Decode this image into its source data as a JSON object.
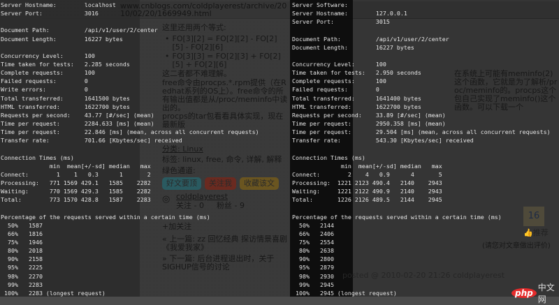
{
  "blog": {
    "url": "www.cnblogs.com/coldplayerest/archive/2010/02/20/1669949.html",
    "p1": "这里还用两个等式:",
    "bullet1": "FO[3][2] = FO[2][2] - FO[2][5] - FO[2][6]",
    "bullet2": "FO[3][3] = FO[2][3] + FO[2][5] + FO[2][6]",
    "p2": "这二者都不难理解。",
    "p3": "free命令由procps.*.rpm提供（在Redhat系列的OS上）。free命令的所有输出值都是从/proc/meminfo中读出的。",
    "p4": "在系统上可能有meminfo(2)这个函数，它就是为了解析/proc/meminfo的。procps这个包自己实现了meminfo()这个函数。可以下载一个",
    "p5": "procps的tar包看看具体实现，现在最新版",
    "category": "分类: Linux",
    "tags": "标签: linux, free, 命令, 详解, 解释",
    "green_channel": "绿色通道:",
    "btn_recommend": "好文要顶",
    "btn_follow": "关注我",
    "btn_favorite": "收藏该文",
    "author": "coldplayerest",
    "following": "关注 - 0",
    "followers": "粉丝 - 9",
    "add_follow": "+加关注",
    "prev": "« 上一篇: zz 回忆经典 探访情景喜剧《我爱我家》",
    "next": "» 下一篇: 后台进程退出时，关于SIGHUP信号的讨论",
    "digg_count": "16",
    "digg_label": "推荐",
    "rate_hint": "(请您对文章做出评价)",
    "posted": "posted @ 2010-02-20 21:26 coldplayerest",
    "logo_php": "php",
    "logo_cn": "中文网"
  },
  "terminal_left": {
    "lines": [
      "Server Hostname:        localhost",
      "Server Port:            3016",
      "",
      "Document Path:          /api/v1/user/2/center",
      "Document Length:        16227 bytes",
      "",
      "Concurrency Level:      100",
      "Time taken for tests:   2.285 seconds",
      "Complete requests:      100",
      "Failed requests:        0",
      "Write errors:           0",
      "Total transferred:      1641500 bytes",
      "HTML transferred:       1622700 bytes",
      "Requests per second:    43.77 [#/sec] (mean)",
      "Time per request:       2284.633 [ms] (mean)",
      "Time per request:       22.846 [ms] (mean, across all concurrent requests)",
      "Transfer rate:          701.66 [Kbytes/sec] received",
      "",
      "Connection Times (ms)",
      "              min  mean[+/-sd] median   max",
      "Connect:        1    1   0.3      1       2",
      "Processing:   771 1569 429.1   1585    2282",
      "Waiting:      770 1569 429.3   1585    2282",
      "Total:        773 1570 428.8   1587    2283",
      "",
      "Percentage of the requests served within a certain time (ms)",
      "  50%   1587",
      "  66%   1816",
      "  75%   1946",
      "  80%   2018",
      "  90%   2158",
      "  95%   2225",
      "  98%   2270",
      "  99%   2283",
      " 100%   2283 (longest request)"
    ]
  },
  "terminal_right": {
    "lines": [
      "Server Software:",
      "Server Hostname:        127.0.0.1",
      "Server Port:            3015",
      "",
      "Document Path:          /api/v1/user/2/center",
      "Document Length:        16227 bytes",
      "",
      "Concurrency Level:      100",
      "Time taken for tests:   2.950 seconds",
      "Complete requests:      100",
      "Failed requests:        0",
      "Total transferred:      1641400 bytes",
      "HTML transferred:       1622700 bytes",
      "Requests per second:    33.89 [#/sec] (mean)",
      "Time per request:       2950.358 [ms] (mean)",
      "Time per request:       29.504 [ms] (mean, across all concurrent requests)",
      "Transfer rate:          543.30 [Kbytes/sec] received",
      "",
      "Connection Times (ms)",
      "              min  mean[+/-sd] median   max",
      "Connect:        2    4   0.9      4       5",
      "Processing:  1221 2123 490.4   2140    2943",
      "Waiting:     1221 2122 490.9   2140    2943",
      "Total:       1226 2126 489.5   2144    2945",
      "",
      "Percentage of the requests served within a certain time (ms)",
      "  50%   2144",
      "  66%   2406",
      "  75%   2554",
      "  80%   2638",
      "  90%   2800",
      "  95%   2879",
      "  98%   2930",
      "  99%   2945",
      " 100%   2945 (longest request)"
    ]
  }
}
